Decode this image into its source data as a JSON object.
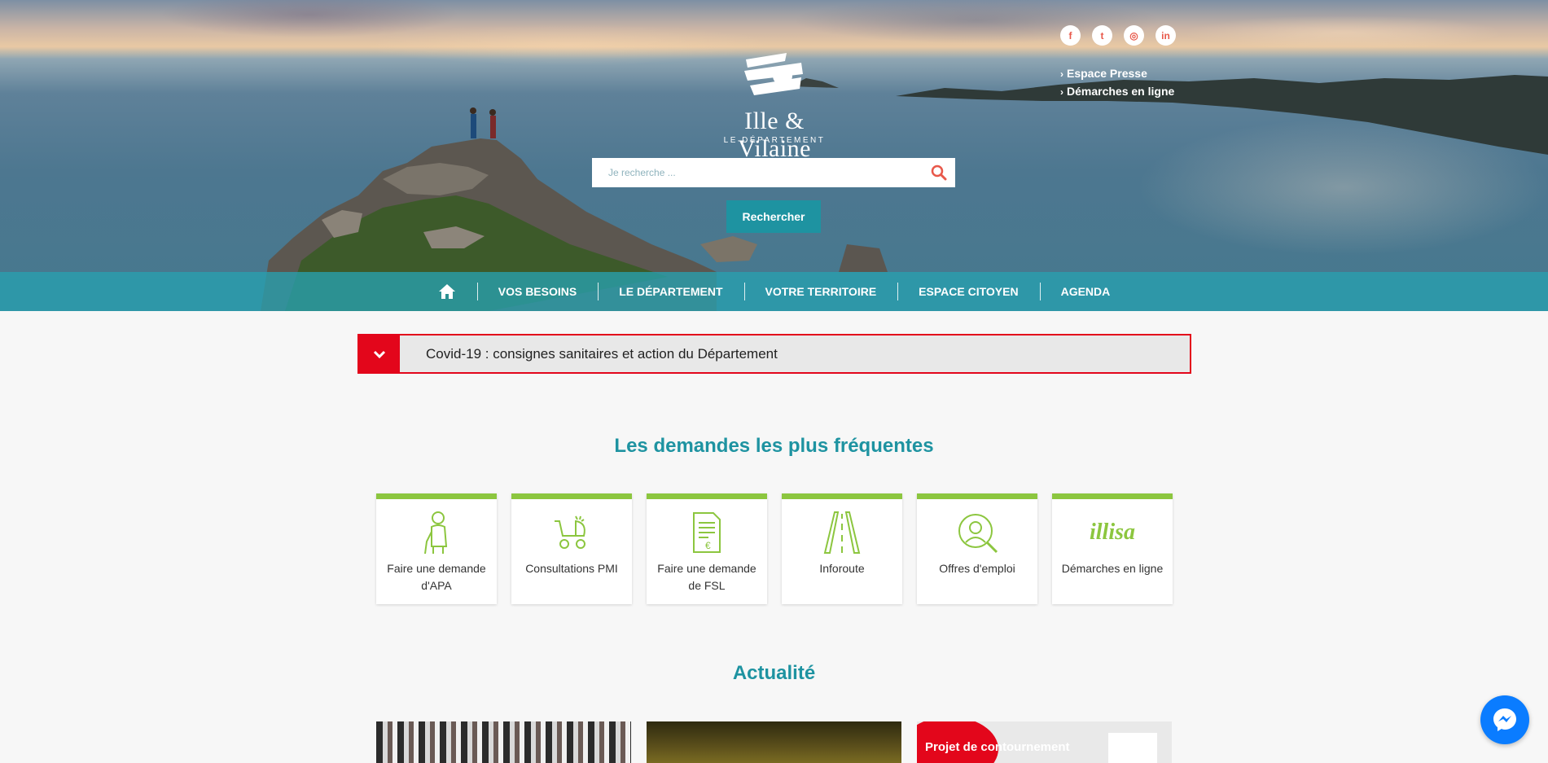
{
  "social": {
    "icons": [
      "facebook-icon",
      "twitter-icon",
      "instagram-icon",
      "linkedin-icon"
    ],
    "glyphs": [
      "f",
      "t",
      "◎",
      "in"
    ]
  },
  "quicklinks": [
    "Espace Presse",
    "Démarches en ligne"
  ],
  "logo": {
    "name": "Ille & Vilaine",
    "sub": "LE DÉPARTEMENT"
  },
  "search": {
    "placeholder": "Je recherche ...",
    "button": "Rechercher"
  },
  "nav": {
    "items": [
      "VOS BESOINS",
      "LE DÉPARTEMENT",
      "VOTRE TERRITOIRE",
      "ESPACE CITOYEN",
      "AGENDA"
    ]
  },
  "alert": {
    "text": "Covid-19 : consignes sanitaires et action du Département",
    "color": "#e3061b"
  },
  "frequent": {
    "title": "Les demandes les plus fréquentes",
    "cards": [
      {
        "label": "Faire une demande d'APA",
        "icon": "elderly-person-icon"
      },
      {
        "label": "Consultations PMI",
        "icon": "baby-stroller-icon"
      },
      {
        "label": "Faire une demande de FSL",
        "icon": "invoice-euro-icon"
      },
      {
        "label": "Inforoute",
        "icon": "road-icon"
      },
      {
        "label": "Offres d'emploi",
        "icon": "job-search-icon"
      },
      {
        "label": "Démarches en ligne",
        "icon": "illisa-logo"
      }
    ],
    "illisa_text": "illisa"
  },
  "news": {
    "title": "Actualité",
    "card3_text": "Projet de contournement"
  },
  "colors": {
    "accent": "#1e93a1",
    "green": "#8cc63f",
    "red": "#e3061b"
  }
}
